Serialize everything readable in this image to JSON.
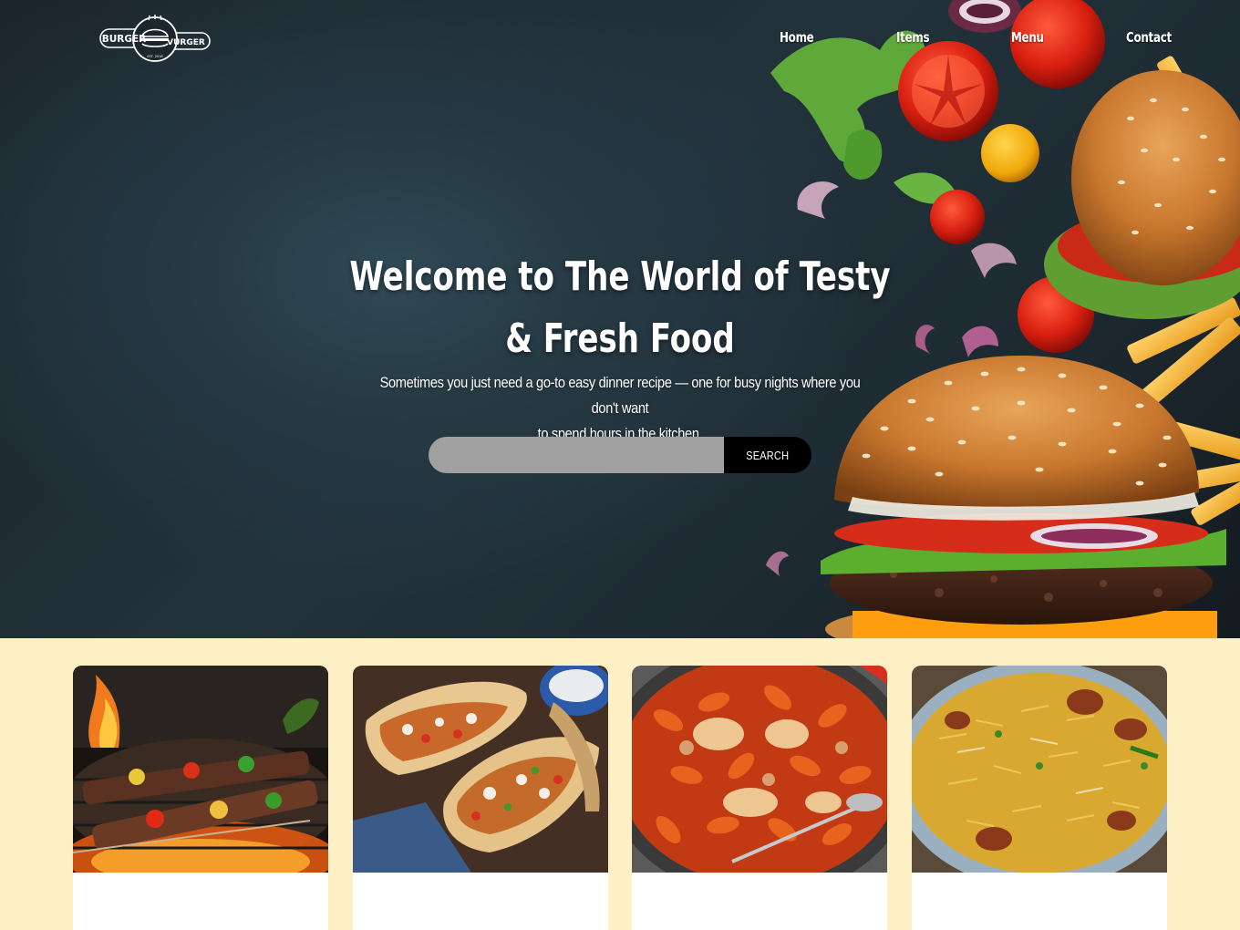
{
  "brand": {
    "logo_word_left": "BURGER",
    "logo_word_right": "VURGER",
    "logo_est": "EST. 2018"
  },
  "nav": {
    "items": [
      {
        "label": "Home"
      },
      {
        "label": "Items"
      },
      {
        "label": "Menu"
      },
      {
        "label": "Contact"
      }
    ]
  },
  "hero": {
    "title_line1": "Welcome to The World of Testy",
    "title_line2": "& Fresh Food",
    "subtitle_line1": "Sometimes you just need a go-to easy dinner recipe — one for busy nights where you don't want",
    "subtitle_line2": "to spend hours in the kitchen.",
    "search": {
      "value": "",
      "placeholder": "",
      "button_label": "SEARCH"
    }
  },
  "cards": [
    {
      "image_icon": "grilled-kebab-image"
    },
    {
      "image_icon": "shawarma-wrap-image"
    },
    {
      "image_icon": "pasta-bake-image"
    },
    {
      "image_icon": "biryani-image"
    }
  ],
  "colors": {
    "page_background": "#fdf0c4",
    "search_field": "#a0a0a0",
    "search_button": "#000000",
    "hero_text": "#ffffff"
  }
}
